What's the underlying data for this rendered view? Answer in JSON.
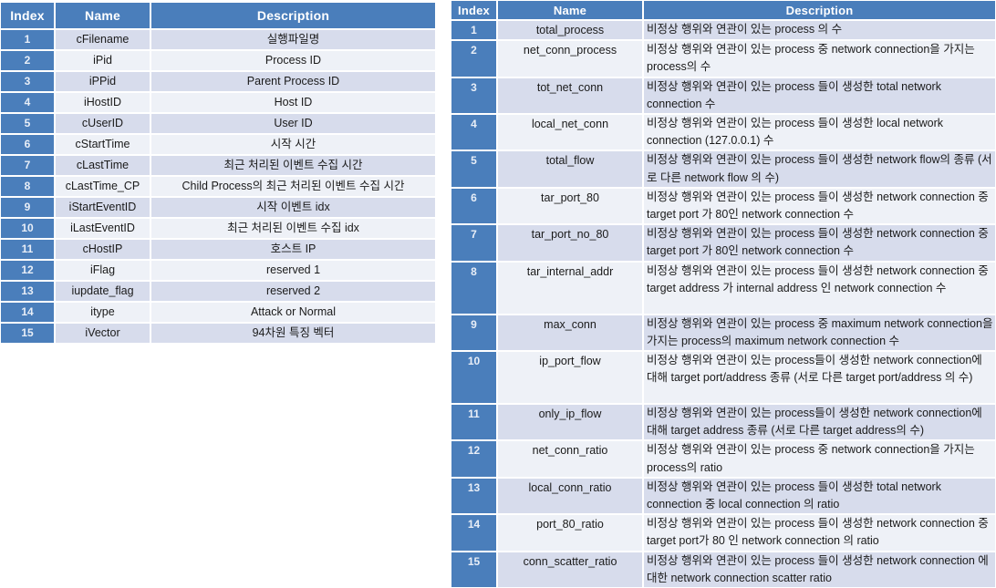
{
  "colors": {
    "header_blue": "#4a7ebb",
    "index_blue": "#4a7ebb",
    "row_even": "#d7dcec",
    "row_odd": "#eef1f7",
    "page_background": "#ffffff",
    "header_text": "#ffffff",
    "body_text": "#1a1a1a"
  },
  "tables": [
    {
      "id": "process-table",
      "columns": [
        "Index",
        "Name",
        "Description"
      ],
      "rows": [
        {
          "index": "1",
          "name": "cFilename",
          "description": "실행파일명"
        },
        {
          "index": "2",
          "name": "iPid",
          "description": "Process ID"
        },
        {
          "index": "3",
          "name": "iPPid",
          "description": "Parent Process ID"
        },
        {
          "index": "4",
          "name": "iHostID",
          "description": "Host ID"
        },
        {
          "index": "5",
          "name": "cUserID",
          "description": "User ID"
        },
        {
          "index": "6",
          "name": "cStartTime",
          "description": "시작 시간"
        },
        {
          "index": "7",
          "name": "cLastTime",
          "description": "최근 처리된 이벤트 수집 시간"
        },
        {
          "index": "8",
          "name": "cLastTime_CP",
          "description": "Child Process의 최근 처리된 이벤트 수집 시간"
        },
        {
          "index": "9",
          "name": "iStartEventID",
          "description": "시작 이벤트 idx"
        },
        {
          "index": "10",
          "name": "iLastEventID",
          "description": "최근 처리된 이벤트 수집 idx"
        },
        {
          "index": "11",
          "name": "cHostIP",
          "description": "호스트 IP"
        },
        {
          "index": "12",
          "name": "iFlag",
          "description": "reserved 1"
        },
        {
          "index": "13",
          "name": "iupdate_flag",
          "description": "reserved 2"
        },
        {
          "index": "14",
          "name": "itype",
          "description": "Attack or Normal"
        },
        {
          "index": "15",
          "name": "iVector",
          "description": "94차원 특징 벡터"
        }
      ]
    },
    {
      "id": "feature-table",
      "columns": [
        "Index",
        "Name",
        "Description"
      ],
      "rows": [
        {
          "index": "1",
          "name": "total_process",
          "lines": 1,
          "description": "비정상 행위와 연관이 있는 process 의 수"
        },
        {
          "index": "2",
          "name": "net_conn_process",
          "lines": 2,
          "description": "비정상 행위와 연관이 있는 process 중 network connection을 가지는 process의 수"
        },
        {
          "index": "3",
          "name": "tot_net_conn",
          "lines": 2,
          "description": "비정상 행위와 연관이 있는 process 들이 생성한 total network connection 수"
        },
        {
          "index": "4",
          "name": "local_net_conn",
          "lines": 2,
          "description": "비정상 행위와 연관이 있는 process 들이 생성한 local network connection (127.0.0.1) 수"
        },
        {
          "index": "5",
          "name": "total_flow",
          "lines": 2,
          "description": "비정상 행위와 연관이 있는 process 들이 생성한 network flow의 종류 (서로 다른 network flow 의 수)"
        },
        {
          "index": "6",
          "name": "tar_port_80",
          "lines": 2,
          "description": "비정상 행위와 연관이 있는 process 들이 생성한 network connection 중 target port 가 80인 network connection 수"
        },
        {
          "index": "7",
          "name": "tar_port_no_80",
          "lines": 2,
          "description": "비정상 행위와 연관이 있는 process 들이 생성한 network connection 중 target port 가 80인 network connection 수"
        },
        {
          "index": "8",
          "name": "tar_internal_addr",
          "lines": 3,
          "description": "비정상 행위와 연관이 있는 process 들이 생성한 network connection 중 target address 가 internal address 인 network connection 수"
        },
        {
          "index": "9",
          "name": "max_conn",
          "lines": 2,
          "description": "비정상 행위와 연관이 있는 process 중 maximum network connection을 가지는 process의 maximum network connection 수"
        },
        {
          "index": "10",
          "name": "ip_port_flow",
          "lines": 3,
          "description": "비정상 행위와 연관이 있는 process들이 생성한 network connection에 대해 target port/address 종류 (서로 다른 target port/address 의 수)"
        },
        {
          "index": "11",
          "name": "only_ip_flow",
          "lines": 2,
          "description": "비정상 행위와 연관이 있는 process들이 생성한 network connection에 대해 target address 종류 (서로 다른 target address의 수)"
        },
        {
          "index": "12",
          "name": "net_conn_ratio",
          "lines": 2,
          "description": "비정상 행위와 연관이 있는 process 중 network connection을 가지는 process의 ratio"
        },
        {
          "index": "13",
          "name": "local_conn_ratio",
          "lines": 2,
          "description": "비정상 행위와 연관이 있는 process 들이 생성한 total network connection 중 local connection 의 ratio"
        },
        {
          "index": "14",
          "name": "port_80_ratio",
          "lines": 2,
          "description": "비정상 행위와 연관이 있는 process 들이 생성한 network connection 중 target port가 80 인 network connection 의 ratio"
        },
        {
          "index": "15",
          "name": "conn_scatter_ratio",
          "lines": 2,
          "description": "비정상 행위와 연관이 있는 process 들이 생성한 network connection 에 대한 network connection scatter ratio"
        }
      ]
    }
  ]
}
